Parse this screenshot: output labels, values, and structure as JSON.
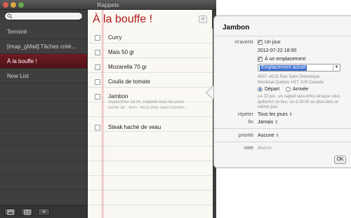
{
  "window": {
    "title": "Rappels"
  },
  "search": {
    "placeholder": ""
  },
  "sidebar": {
    "items": [
      {
        "label": "Terminé"
      },
      {
        "label": "[imap_gMail]:Tâches créé..."
      },
      {
        "label": "À la bouffe !"
      },
      {
        "label": "New List"
      }
    ],
    "bottom_buttons": [
      {
        "icon": "calendar-icon"
      },
      {
        "icon": "grid-icon"
      },
      {
        "label": "+"
      }
    ]
  },
  "list": {
    "title": "À la bouffe !",
    "add_label": "+",
    "reminders": [
      {
        "text": "Curry"
      },
      {
        "text": "Mais  50 gr"
      },
      {
        "text": "Mozarella 70 gr"
      },
      {
        "text": "Coulis de tomate"
      },
      {
        "text": "Jambon",
        "sub1": "Aujourd'hui 18:00, Répéter tous les jours",
        "sub2": "Sortie de : 4507–4515 Rue Saint Domini..."
      },
      {
        "text": "Steak haché de veau"
      }
    ]
  },
  "popover": {
    "title": "Jambon",
    "remind_label": "m'avertir",
    "on_day": "Un jour",
    "date": "2012-07-22  18:00",
    "at_location": "À un emplacement",
    "location_value": "Emplacement actuel",
    "address1": "4507–4515 Rue Saint Dominique",
    "address2": "Montréal Québec H2T 1V9 Canada",
    "depart": "Départ",
    "arrive": "Arrivée",
    "info": "Le 22 juil., un rappel sera émis lorsque vous quitterez ce lieu, ou à 18:00 au plus tard ce même jour.",
    "repeat_label": "répéter",
    "repeat_value": "Tous les jours",
    "end_label": "fin",
    "end_value": "Jamais",
    "priority_label": "priorité",
    "priority_value": "Aucune",
    "note_label": "note",
    "note_value": "Aucun",
    "ok_label": "OK"
  },
  "colors": {
    "accent_red": "#b01717",
    "selected_row": "#6e1b22"
  }
}
